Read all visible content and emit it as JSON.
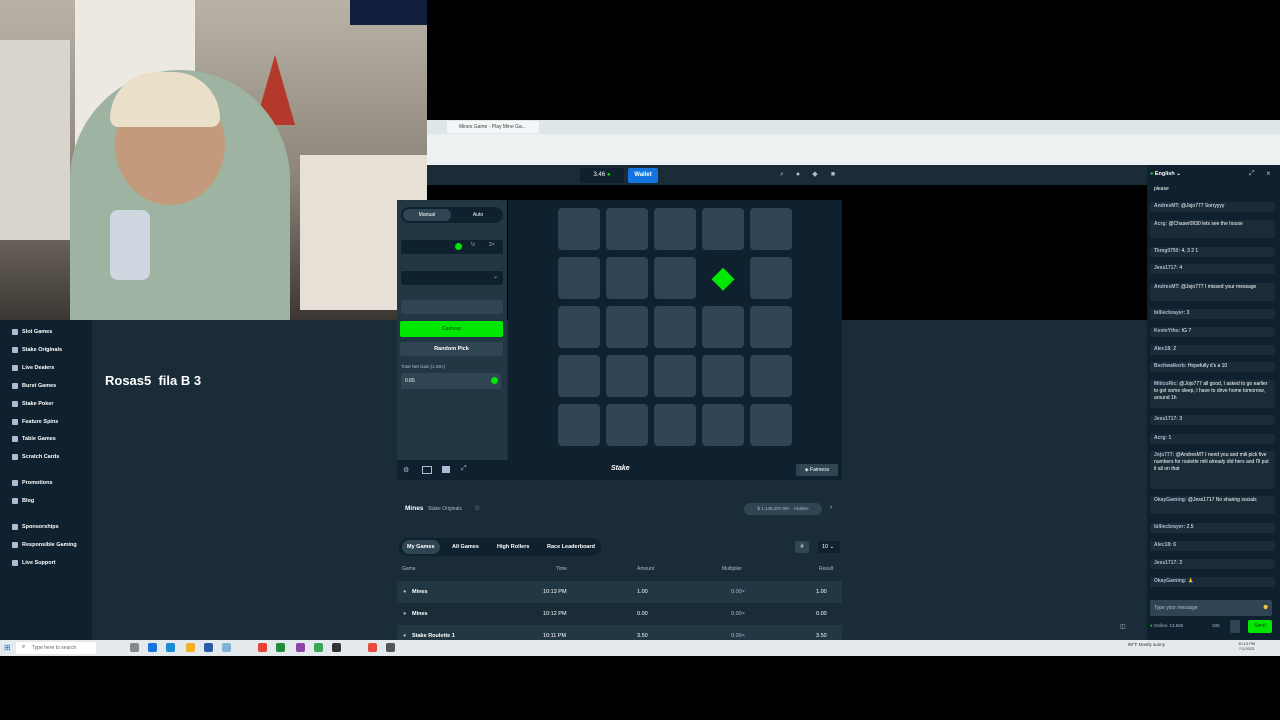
{
  "webcam": {
    "label": "streamer webcam"
  },
  "browser": {
    "tab_title": "Mines Game - Play Mine Ga...",
    "colors": {
      "tabbar": "#dfe6e9"
    }
  },
  "header": {
    "balance": "3.46",
    "wallet_label": "Wallet"
  },
  "sidebar": {
    "items": [
      {
        "label": "Slot Games",
        "icon": "slot-icon"
      },
      {
        "label": "Stake Originals",
        "icon": "originals-icon"
      },
      {
        "label": "Live Dealers",
        "icon": "live-icon"
      },
      {
        "label": "Burst Games",
        "icon": "burst-icon"
      },
      {
        "label": "Stake Poker",
        "icon": "poker-icon"
      },
      {
        "label": "Feature Spins",
        "icon": "spins-icon"
      },
      {
        "label": "Table Games",
        "icon": "table-icon"
      },
      {
        "label": "Scratch Cards",
        "icon": "scratch-icon"
      },
      {
        "label": "Promotions",
        "icon": "promo-icon"
      },
      {
        "label": "Blog",
        "icon": "blog-icon"
      },
      {
        "label": "Sponsorships",
        "icon": "sponsor-icon"
      },
      {
        "label": "Responsible Gaming",
        "icon": "shield-icon"
      },
      {
        "label": "Live Support",
        "icon": "support-icon"
      }
    ]
  },
  "overlay_text": "Rosas5  fila B 3",
  "game": {
    "mode_tabs": [
      "Manual",
      "Auto"
    ],
    "half_label": "½",
    "double_label": "2×",
    "cashout_label": "Cashout",
    "random_pick_label": "Random Pick",
    "profit_label": "Total Net Gain (1.65×)",
    "profit_value": "0.65",
    "grid_rows": 5,
    "grid_cols": 5,
    "gem_cell": [
      1,
      3
    ],
    "logo": "Stake",
    "fairness_label": "Fairness"
  },
  "info": {
    "title": "Mines",
    "subtitle": "Stake Originals",
    "badge": "$ 1,148,297.00+",
    "badge_suffix": "Hidden"
  },
  "bets": {
    "tabs": [
      "My Games",
      "All Games",
      "High Rollers",
      "Race Leaderboard"
    ],
    "page_size": "10",
    "columns": [
      "Game",
      "Time",
      "Amount",
      "Multiplier",
      "Result"
    ],
    "rows": [
      {
        "game": "Mines",
        "time": "10:13 PM",
        "amount": "1.00",
        "multiplier": "0.00×",
        "result": "1.00"
      },
      {
        "game": "Mines",
        "time": "10:12 PM",
        "amount": "0.00",
        "multiplier": "0.00×",
        "result": "0.00"
      },
      {
        "game": "Stake Roulette 1",
        "time": "10:11 PM",
        "amount": "3.50",
        "multiplier": "0.00×",
        "result": "3.50"
      }
    ]
  },
  "chat": {
    "language": "English",
    "messages": [
      {
        "user": "",
        "text": "please"
      },
      {
        "user": "AndresMT:",
        "text": "@Jojo777 Sorryyyy"
      },
      {
        "user": "Acrg:",
        "text": "@Chaser0930 lets see the house"
      },
      {
        "user": "Tkmg0750:",
        "text": "4, 3 2 1"
      },
      {
        "user": "Jess1717:",
        "text": "4"
      },
      {
        "user": "AndresMT:",
        "text": "@Jojo777 I missed your message"
      },
      {
        "user": "billiecbrayer:",
        "text": "3"
      },
      {
        "user": "KevinYtho:",
        "text": "IG 7"
      },
      {
        "user": "Alec18:",
        "text": "2"
      },
      {
        "user": "Bschwalkerb:",
        "text": "Hopefully it's a 10"
      },
      {
        "user": "MiticoRic:",
        "text": "@Jojo777 all good, I asked to go earlier to get some sleep, I have to drive home tomorrow, around 1h"
      },
      {
        "user": "Jess1717:",
        "text": "3"
      },
      {
        "user": "Acrg:",
        "text": "1"
      },
      {
        "user": "Jojo777:",
        "text": "@AndresMT I need you and mili pick five numbers for roulette mili already did hers and I'll put it all on that"
      },
      {
        "user": "OkayGaming:",
        "text": "@Jess1717  No sharing socials"
      },
      {
        "user": "billiecbrayer:",
        "text": "2.5"
      },
      {
        "user": "Alec18:",
        "text": "6"
      },
      {
        "user": "Jess1717:",
        "text": "2"
      },
      {
        "user": "OkayGaming:",
        "text": "🙏"
      }
    ],
    "input_placeholder": "Type your message",
    "online": "Online: 13,665",
    "rules_count": "100",
    "send_label": "Send"
  },
  "taskbar": {
    "search_placeholder": "Type here to search",
    "weather": "90°F  Mostly sunny",
    "clock_time": "10:13 PM",
    "clock_date": "7/1/2023"
  }
}
